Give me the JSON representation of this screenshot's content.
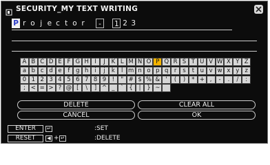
{
  "window": {
    "title": "SECURITY_MY TEXT WRITING",
    "close_icon": "close-x-icon",
    "title_icon": "security-icon"
  },
  "entry": {
    "chars": [
      "P",
      "r",
      "o",
      "j",
      "e",
      "c",
      "t",
      "o",
      "r",
      " ",
      "-",
      " ",
      "1",
      "2",
      "3"
    ],
    "cursor_index": 0,
    "boxed_indices": [
      10,
      12
    ]
  },
  "keyboard": {
    "rows": [
      [
        "A",
        "B",
        "C",
        "D",
        "E",
        "F",
        "G",
        "H",
        "I",
        "J",
        "K",
        "L",
        "M",
        "N",
        "O",
        "P",
        "Q",
        "R",
        "S",
        "T",
        "U",
        "V",
        "W",
        "X",
        "Y",
        "Z"
      ],
      [
        "a",
        "b",
        "c",
        "d",
        "e",
        "f",
        "g",
        "h",
        "i",
        "j",
        "k",
        "l",
        "m",
        "n",
        "o",
        "p",
        "q",
        "r",
        "s",
        "t",
        "u",
        "v",
        "w",
        "x",
        "y",
        "z"
      ],
      [
        "0",
        "1",
        "2",
        "3",
        "4",
        "5",
        "6",
        "7",
        "8",
        "9",
        "!",
        "\"",
        "#",
        "$",
        "%",
        "&",
        "'",
        "(",
        ")",
        "*",
        "+",
        ",",
        "-",
        ".",
        "/",
        ":"
      ],
      [
        ";",
        "<",
        "=",
        ">",
        "?",
        "@",
        "[",
        "\\",
        "]",
        "^",
        "_",
        "`",
        "{",
        "|",
        "}",
        "~",
        " "
      ]
    ],
    "selected": "P"
  },
  "buttons": {
    "delete": "DELETE",
    "clear_all": "CLEAR ALL",
    "cancel": "CANCEL",
    "ok": "OK"
  },
  "footer": {
    "enter": {
      "key": "ENTER",
      "action": ":SET",
      "icon": "enter-key-icon"
    },
    "reset": {
      "key": "RESET",
      "action": ":DELETE",
      "icons": [
        "left-arrow-icon",
        "enter-key-icon"
      ],
      "plus": "+"
    }
  },
  "colors": {
    "background": "#0c0c0c",
    "key": "#d6d6d6",
    "selected_key": "#f5b400",
    "cursor": "#f2f2f2"
  }
}
